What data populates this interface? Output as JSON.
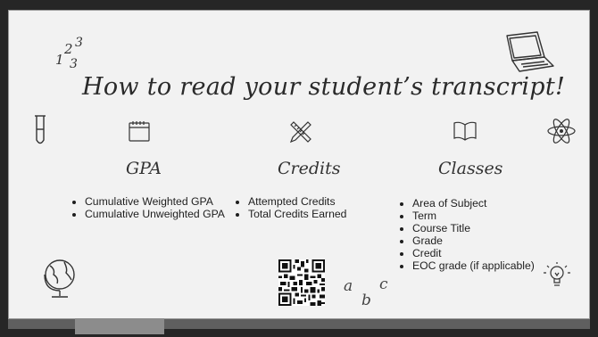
{
  "slide": {
    "title": "How to read your student’s transcript!"
  },
  "columns": [
    {
      "heading": "GPA",
      "icon": "calendar-icon",
      "items": [
        "Cumulative Weighted GPA",
        "Cumulative Unweighted GPA"
      ]
    },
    {
      "heading": "Credits",
      "icon": "pencil-ruler-icon",
      "items": [
        "Attempted Credits",
        "Total Credits Earned"
      ]
    },
    {
      "heading": "Classes",
      "icon": "open-book-icon",
      "items": [
        "Area of Subject",
        "Term",
        "Course Title",
        "Grade",
        "Credit",
        "EOC grade (if applicable)"
      ]
    }
  ],
  "doodles": {
    "numbers_label": "123",
    "abc_label": "a b c",
    "icons": [
      "numbers-doodle-icon",
      "laptop-icon",
      "test-tube-icon",
      "atom-icon",
      "globe-icon",
      "qr-code-icon",
      "abc-doodle-icon",
      "lightbulb-icon"
    ]
  },
  "colors": {
    "board": "#f2f2f2",
    "frame": "#262626",
    "ink": "#2a2a2a"
  }
}
